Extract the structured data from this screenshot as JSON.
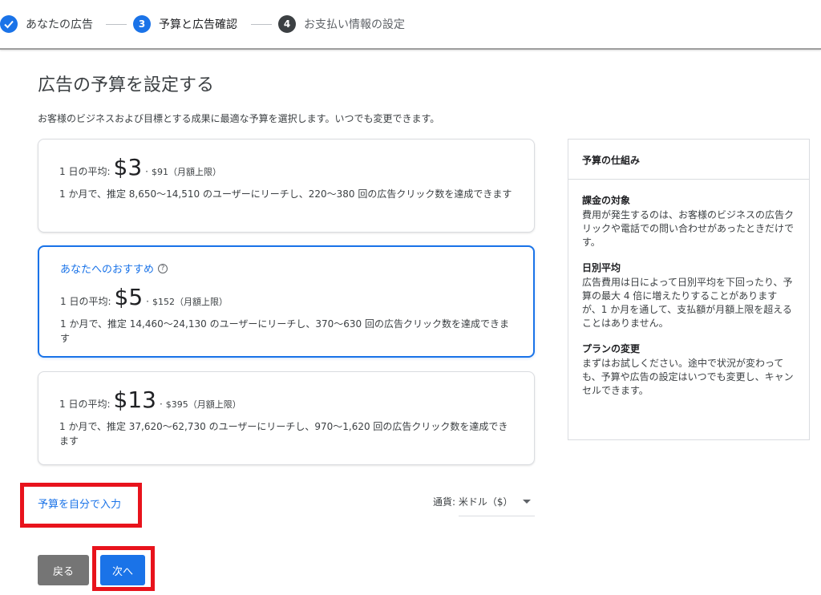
{
  "stepper": {
    "step1_label": "あなたの広告",
    "step2_num": "3",
    "step2_label": "予算と広告確認",
    "step3_num": "4",
    "step3_label": "お支払い情報の設定"
  },
  "main": {
    "title": "広告の予算を設定する",
    "subtitle": "お客様のビジネスおよび目標とする成果に最適な予算を選択します。いつでも変更できます。"
  },
  "options": [
    {
      "daily_prefix": "1 日の平均:",
      "daily_amount": "$3",
      "dot": "·",
      "monthly": "$91（月額上限）",
      "description": "1 か月で、推定 8,650〜14,510 のユーザーにリーチし、220〜380 回の広告クリック数を達成できます"
    },
    {
      "recommendation": "あなたへのおすすめ",
      "daily_prefix": "1 日の平均:",
      "daily_amount": "$5",
      "dot": "·",
      "monthly": "$152（月額上限）",
      "description": "1 か月で、推定 14,460〜24,130 のユーザーにリーチし、370〜630 回の広告クリック数を達成できます"
    },
    {
      "daily_prefix": "1 日の平均:",
      "daily_amount": "$13",
      "dot": "·",
      "monthly": "$395（月額上限）",
      "description": "1 か月で、推定 37,620〜62,730 のユーザーにリーチし、970〜1,620 回の広告クリック数を達成できます"
    }
  ],
  "selected_option": 1,
  "info_panel": {
    "title": "予算の仕組み",
    "sections": [
      {
        "heading": "課金の対象",
        "text": "費用が発生するのは、お客様のビジネスの広告クリックや電話での問い合わせがあったときだけです。"
      },
      {
        "heading": "日別平均",
        "text": "広告費用は日によって日別平均を下回ったり、予算の最大 4 倍に増えたりすることがありますが、1 か月を通して、支払額が月額上限を超えることはありません。"
      },
      {
        "heading": "プランの変更",
        "text": "まずはお試しください。途中で状況が変わっても、予算や広告の設定はいつでも変更し、キャンセルできます。"
      }
    ]
  },
  "manual_budget_link": "予算を自分で入力",
  "currency": {
    "label": "通貨: 米ドル（$）"
  },
  "buttons": {
    "back": "戻る",
    "next": "次へ"
  },
  "colors": {
    "accent": "#1a73e8",
    "highlight": "#e8131c",
    "back_button": "#757575"
  },
  "icons": {
    "step1": "check-icon",
    "recommendation": "help-icon",
    "currency": "dropdown-arrow-icon"
  }
}
